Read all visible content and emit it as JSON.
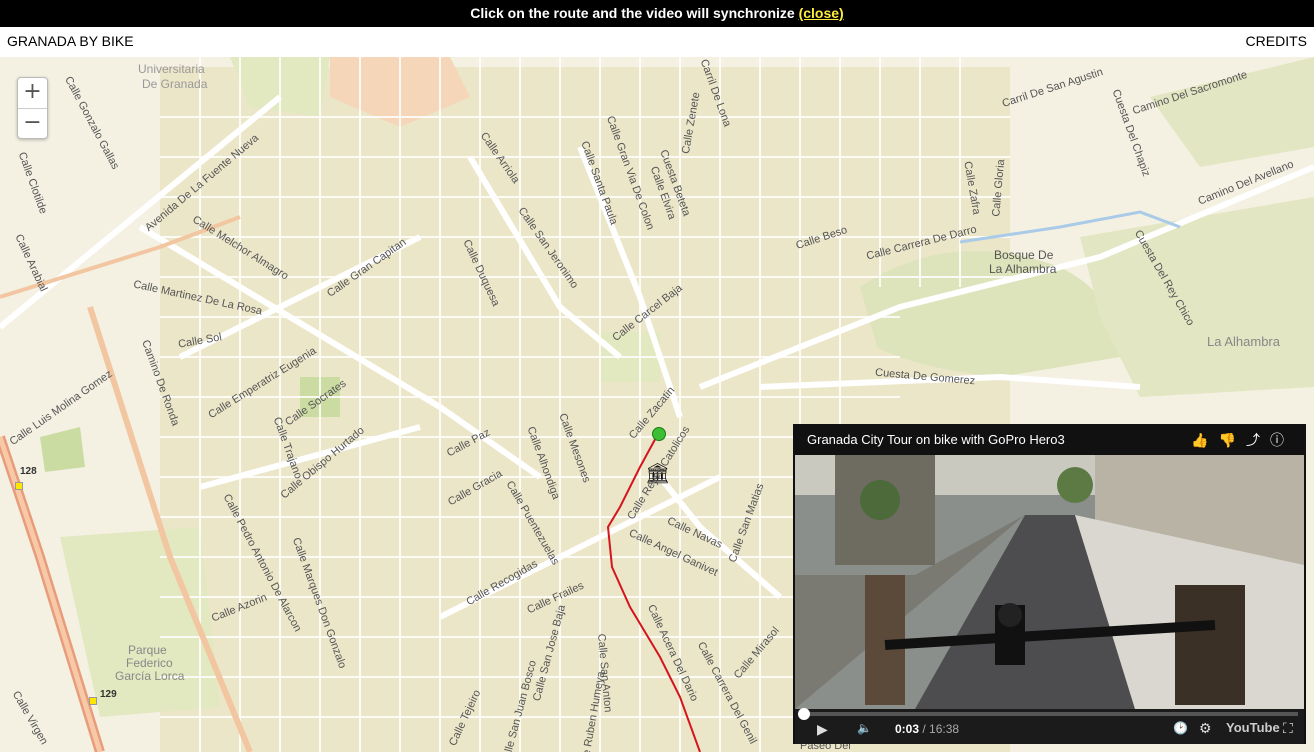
{
  "banner": {
    "text": "Click on the route and the video will synchronize",
    "close_label": "(close)"
  },
  "header": {
    "title": "GRANADA BY BIKE",
    "credits": "CREDITS"
  },
  "zoom": {
    "in": "+",
    "out": "−"
  },
  "map": {
    "labels": [
      "Universitaria",
      "De Granada",
      "Calle Gonzalo Gallas",
      "Avenida De La Fuente Nueva",
      "Calle Melchor Almagro",
      "Calle Martinez De La Rosa",
      "Calle Arabial",
      "Calle Sol",
      "Camino De Ronda",
      "Calle Emperatriz Eugenia",
      "Calle Socrates",
      "Calle Gran Capitan",
      "Calle Duquesa",
      "Calle San Jeronimo",
      "Calle Arriola",
      "Calle Santa Paula",
      "Calle Gran Via De Colon",
      "Calle Elvira",
      "Cuesta Beteta",
      "Calle Zenete",
      "Carril De Lona",
      "Calle Carcel Baja",
      "Calle Zacatin",
      "Calle Reyes Catolicos",
      "Calle Obispo Hurtado",
      "Calle Trajano",
      "Calle Paz",
      "Calle Gracia",
      "Calle Alhondiga",
      "Calle Mesones",
      "Calle Puentezuelas",
      "Calle Navas",
      "Calle San Matias",
      "Calle Angel Ganivet",
      "Calle Recogidas",
      "Calle Frailes",
      "Calle San Jose Baja",
      "Calle San Anton",
      "Calle Acera Del Dario",
      "Calle Carrera Del Genil",
      "Calle Mirasol",
      "Calle Pedro Antonio De Alarcon",
      "Calle Azorin",
      "Calle Marques Don Gonzalo",
      "Calle Tejeiro",
      "Calle San Juan Bosco",
      "Calle Beso",
      "Calle Carrera De Darro",
      "Bosque De",
      "La Alhambra",
      "La Alhambra",
      "Cuesta De Gomerez",
      "Camino Del Sacromonte",
      "Carril De San Agustin",
      "Cuesta Del Chapiz",
      "Camino Del Avellano",
      "Cuesta Del Rey Chico",
      "Calle Zafra",
      "Calle Gloria",
      "Parque",
      "Federico",
      "García Lorca",
      "128",
      "129",
      "Paseo Del",
      "Calle Luis Molina Gomez",
      "Calle Virgen",
      "Calle Clotilde",
      "Calle Ruben Humeya"
    ]
  },
  "video": {
    "title": "Granada City Tour on bike with GoPro Hero3",
    "current_time": "0:03",
    "separator": " / ",
    "duration": "16:38",
    "progress": 0.003,
    "brand": "YouTube"
  }
}
